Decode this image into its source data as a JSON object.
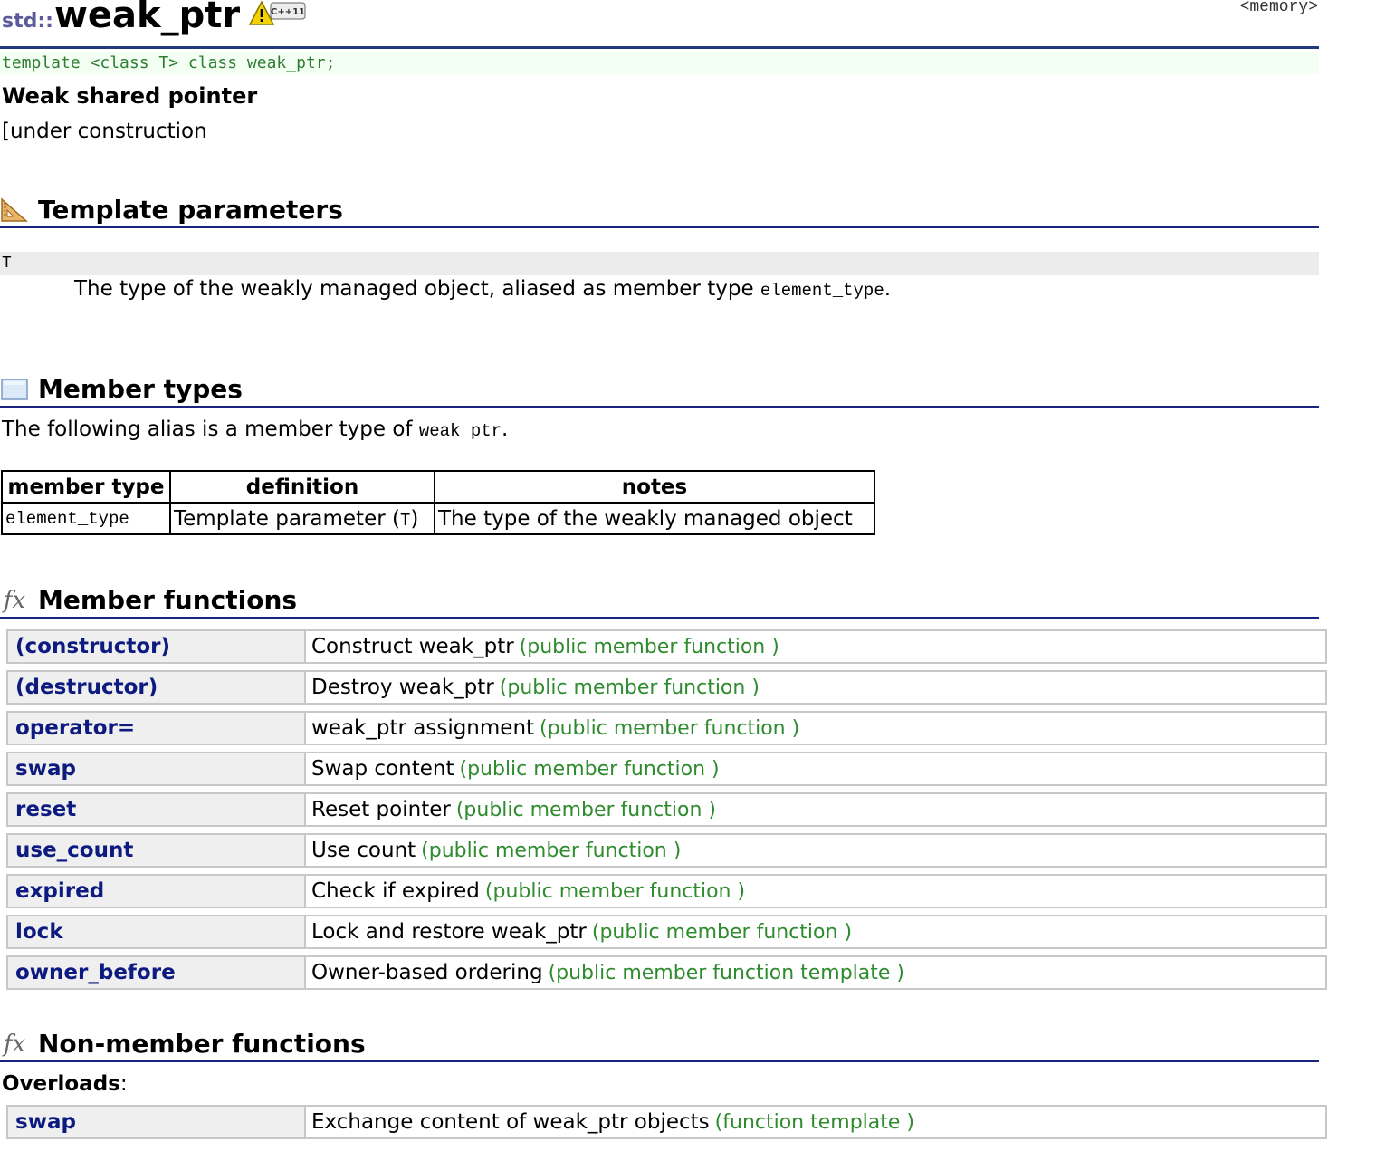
{
  "header": {
    "namespace": "std::",
    "title": "weak_ptr",
    "badge_text": "C++11",
    "include": "<memory>"
  },
  "prototype": "template <class T> class weak_ptr;",
  "brief": "Weak shared pointer",
  "construction_note": "[under construction",
  "template_params": {
    "heading": "Template parameters",
    "param_name": "T",
    "desc_text": "The type of the weakly managed object, aliased as member type ",
    "desc_code": "element_type",
    "desc_end": "."
  },
  "member_types": {
    "heading": "Member types",
    "intro_text": "The following alias is a member type of ",
    "intro_code": "weak_ptr",
    "intro_end": ".",
    "columns": [
      "member type",
      "definition",
      "notes"
    ],
    "rows": [
      {
        "type": "element_type",
        "def_text": "Template parameter (",
        "def_code": "T",
        "def_end": ")",
        "notes": "The type of the weakly managed object"
      }
    ]
  },
  "member_functions": {
    "heading": "Member functions",
    "items": [
      {
        "name": "(constructor)",
        "desc": "Construct weak_ptr",
        "kind": "(public member function )"
      },
      {
        "name": "(destructor)",
        "desc": "Destroy weak_ptr",
        "kind": "(public member function )"
      },
      {
        "name": "operator=",
        "desc": "weak_ptr assignment",
        "kind": "(public member function )"
      },
      {
        "name": "swap",
        "desc": "Swap content",
        "kind": "(public member function )"
      },
      {
        "name": "reset",
        "desc": "Reset pointer",
        "kind": "(public member function )"
      },
      {
        "name": "use_count",
        "desc": "Use count",
        "kind": "(public member function )"
      },
      {
        "name": "expired",
        "desc": "Check if expired",
        "kind": "(public member function )"
      },
      {
        "name": "lock",
        "desc": "Lock and restore weak_ptr",
        "kind": "(public member function )"
      },
      {
        "name": "owner_before",
        "desc": "Owner-based ordering",
        "kind": "(public member function template )"
      }
    ]
  },
  "non_member_functions": {
    "heading": "Non-member functions",
    "overloads_label": "Overloads",
    "overloads_colon": ":",
    "items": [
      {
        "name": "swap",
        "desc": "Exchange content of weak_ptr objects",
        "kind": "(function template )"
      }
    ]
  }
}
